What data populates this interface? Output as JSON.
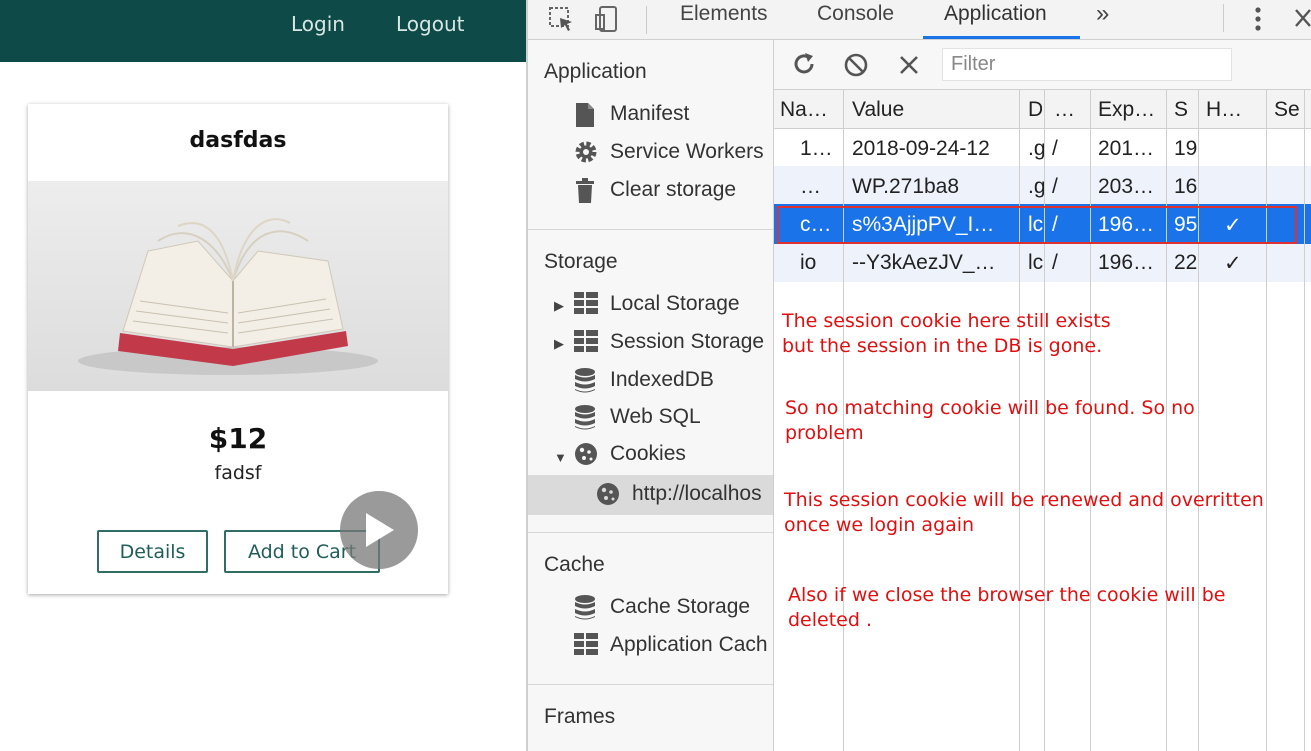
{
  "nav": {
    "login": "Login",
    "logout": "Logout"
  },
  "card": {
    "title": "dasfdas",
    "price": "$12",
    "description": "fadsf",
    "details_button": "Details",
    "add_to_cart_button": "Add to Cart"
  },
  "devtools": {
    "tabs": [
      "Elements",
      "Console",
      "Application"
    ],
    "more_tabs": "»",
    "filter_placeholder": "Filter",
    "sidebar": {
      "application": {
        "heading": "Application",
        "items": [
          "Manifest",
          "Service Workers",
          "Clear storage"
        ]
      },
      "storage": {
        "heading": "Storage",
        "items": [
          "Local Storage",
          "Session Storage",
          "IndexedDB",
          "Web SQL",
          "Cookies"
        ],
        "cookie_origin": "http://localhos"
      },
      "cache": {
        "heading": "Cache",
        "items": [
          "Cache Storage",
          "Application Cach"
        ]
      },
      "frames": {
        "heading": "Frames"
      }
    },
    "columns": [
      "Na…",
      "Value",
      "D",
      "…",
      "Exp…",
      "S",
      "H…",
      "Se"
    ],
    "rows": [
      {
        "name": "1…",
        "value": "2018-09-24-12",
        "domain": ".g",
        "path": "/",
        "expires": "201…",
        "size": "19",
        "httponly": ""
      },
      {
        "name": "…",
        "value": "WP.271ba8",
        "domain": ".g",
        "path": "/",
        "expires": "203…",
        "size": "16",
        "httponly": ""
      },
      {
        "name": "c…",
        "value": "s%3AjjpPV_I…",
        "domain": "lc",
        "path": "/",
        "expires": "196…",
        "size": "95",
        "httponly": "✓"
      },
      {
        "name": "io",
        "value": "--Y3kAezJV_…",
        "domain": "lc",
        "path": "/",
        "expires": "196…",
        "size": "22",
        "httponly": "✓"
      }
    ]
  },
  "notes": [
    [
      "The session cookie here still exists",
      "but the session in the DB is gone."
    ],
    [
      "So no matching cookie will be found. So no",
      "problem"
    ],
    [
      "This session cookie will be renewed and overritten",
      "once we login again"
    ],
    [
      "Also if we close the browser the cookie will be",
      "deleted ."
    ]
  ],
  "colors": {
    "navbar": "#0e4b48",
    "button_border": "#2f6d66",
    "selection": "#1a73e8",
    "annotation": "#e01010"
  }
}
